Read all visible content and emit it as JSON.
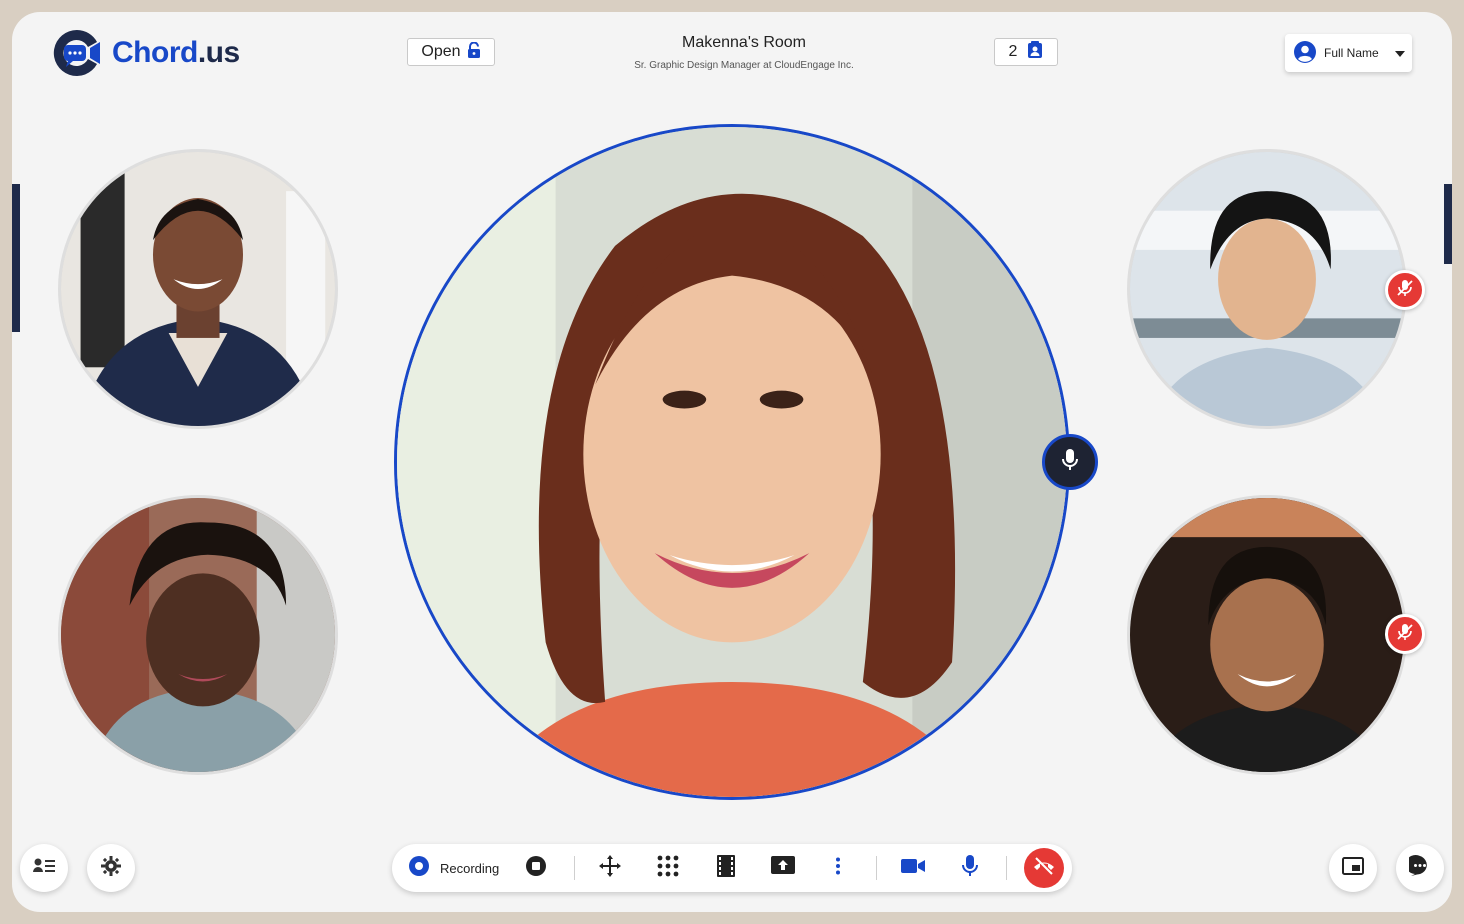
{
  "header": {
    "brand": {
      "name": "Chord",
      "dot": ".",
      "tld": "us"
    },
    "lock_status": "Open",
    "room_title": "Makenna's Room",
    "room_subtitle": "Sr. Graphic Design Manager at CloudEngage Inc.",
    "participant_count": "2",
    "user_menu_label": "Full Name"
  },
  "participants": [
    {
      "position": "left-top",
      "muted": false,
      "icon": "avatar-photo"
    },
    {
      "position": "left-bottom",
      "muted": false,
      "icon": "avatar-photo"
    },
    {
      "position": "center",
      "speaking": true,
      "icon": "avatar-photo"
    },
    {
      "position": "right-top",
      "muted": true,
      "icon": "mic-off-icon"
    },
    {
      "position": "right-bottom",
      "muted": true,
      "icon": "mic-off-icon"
    }
  ],
  "toolbar": {
    "recording_label": "Recording",
    "buttons": [
      "record-icon",
      "stop-icon",
      "move-icon",
      "grid-icon",
      "film-icon",
      "share-screen-icon",
      "more-vert-icon",
      "camera-icon",
      "mic-icon",
      "end-call-icon"
    ]
  },
  "bottom_left": [
    "participants-list-icon",
    "gear-icon"
  ],
  "bottom_right": [
    "picture-in-picture-icon",
    "chat-icon"
  ],
  "colors": {
    "accent": "#1848c8",
    "danger": "#e53935",
    "navy": "#1e2a4a",
    "background": "#f4f4f4",
    "outer": "#d9cfc2"
  }
}
